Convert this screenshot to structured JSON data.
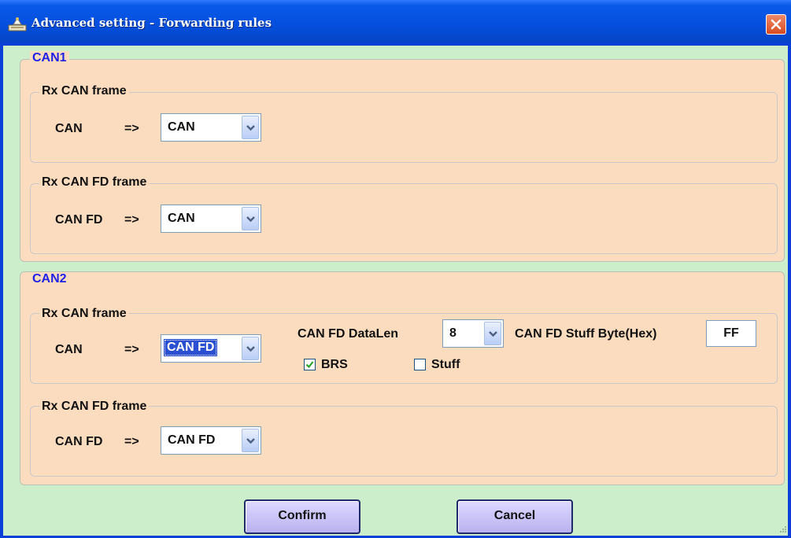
{
  "window": {
    "title": "Advanced setting - Forwarding rules",
    "colors": {
      "titlebar": "#0550e0",
      "background": "#cdeecb",
      "group_fill": "#fbdcbf",
      "group_title": "#1d22e6",
      "button": "#c6c0f5"
    },
    "icons": {
      "app": "app-icon",
      "close": "close-icon"
    }
  },
  "can1": {
    "title": "CAN1",
    "rx_can_frame": {
      "title": "Rx CAN frame",
      "source_label": "CAN",
      "arrow": "=>",
      "target": "CAN"
    },
    "rx_canfd_frame": {
      "title": "Rx CAN FD frame",
      "source_label": "CAN FD",
      "arrow": "=>",
      "target": "CAN"
    }
  },
  "can2": {
    "title": "CAN2",
    "rx_can_frame": {
      "title": "Rx CAN frame",
      "source_label": "CAN",
      "arrow": "=>",
      "target": "CAN FD",
      "datalen_label": "CAN FD DataLen",
      "datalen": "8",
      "stuff_byte_label": "CAN FD Stuff Byte(Hex)",
      "stuff_byte": "FF",
      "brs_label": "BRS",
      "brs_checked": true,
      "stuff_label": "Stuff",
      "stuff_checked": false
    },
    "rx_canfd_frame": {
      "title": "Rx CAN FD frame",
      "source_label": "CAN FD",
      "arrow": "=>",
      "target": "CAN FD"
    }
  },
  "buttons": {
    "confirm": "Confirm",
    "cancel": "Cancel"
  }
}
